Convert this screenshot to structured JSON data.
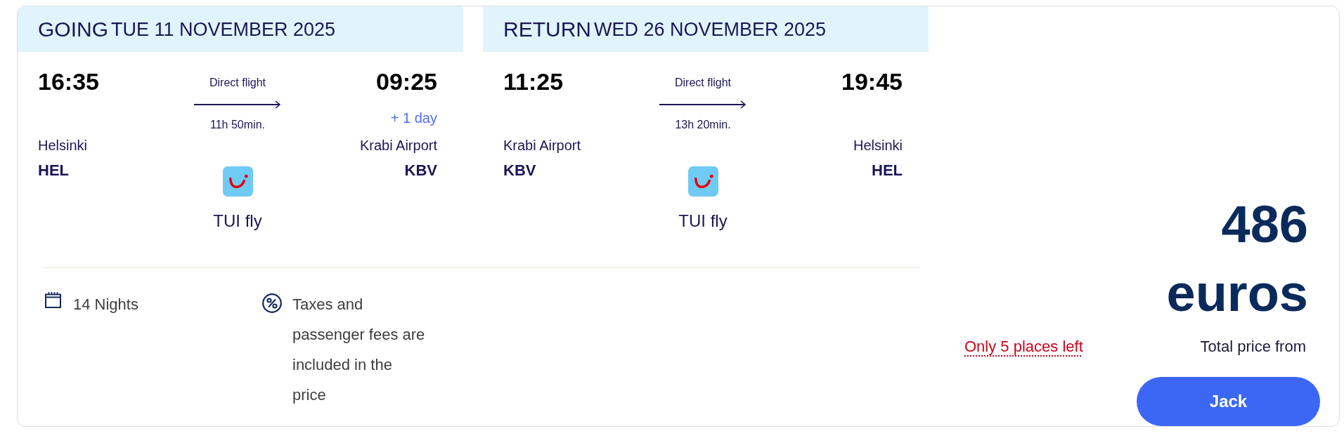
{
  "legs": [
    {
      "direction": "GOING",
      "date": "TUE 11 NOVEMBER 2025",
      "departure": {
        "time": "16:35",
        "city": "Helsinki",
        "code": "HEL"
      },
      "flight_type": "Direct flight",
      "duration": "11h 50min.",
      "arrival": {
        "time": "09:25",
        "day_offset": "+ 1 day",
        "city": "Krabi Airport",
        "code": "KBV"
      },
      "airline": "TUI fly"
    },
    {
      "direction": "RETURN",
      "date": "WED 26 NOVEMBER 2025",
      "departure": {
        "time": "11:25",
        "city": "Krabi Airport",
        "code": "KBV"
      },
      "flight_type": "Direct flight",
      "duration": "13h 20min.",
      "arrival": {
        "time": "19:45",
        "city": "Helsinki",
        "code": "HEL"
      },
      "airline": "TUI fly"
    }
  ],
  "details": [
    {
      "kind": "nights",
      "text": "14 Nights"
    },
    {
      "kind": "fees",
      "text": "Taxes and passenger fees are included in the price"
    }
  ],
  "price": {
    "amount": "486",
    "currency": "euros",
    "availability": "Only 5 places left",
    "label": "Total price from",
    "button": "Jack"
  }
}
